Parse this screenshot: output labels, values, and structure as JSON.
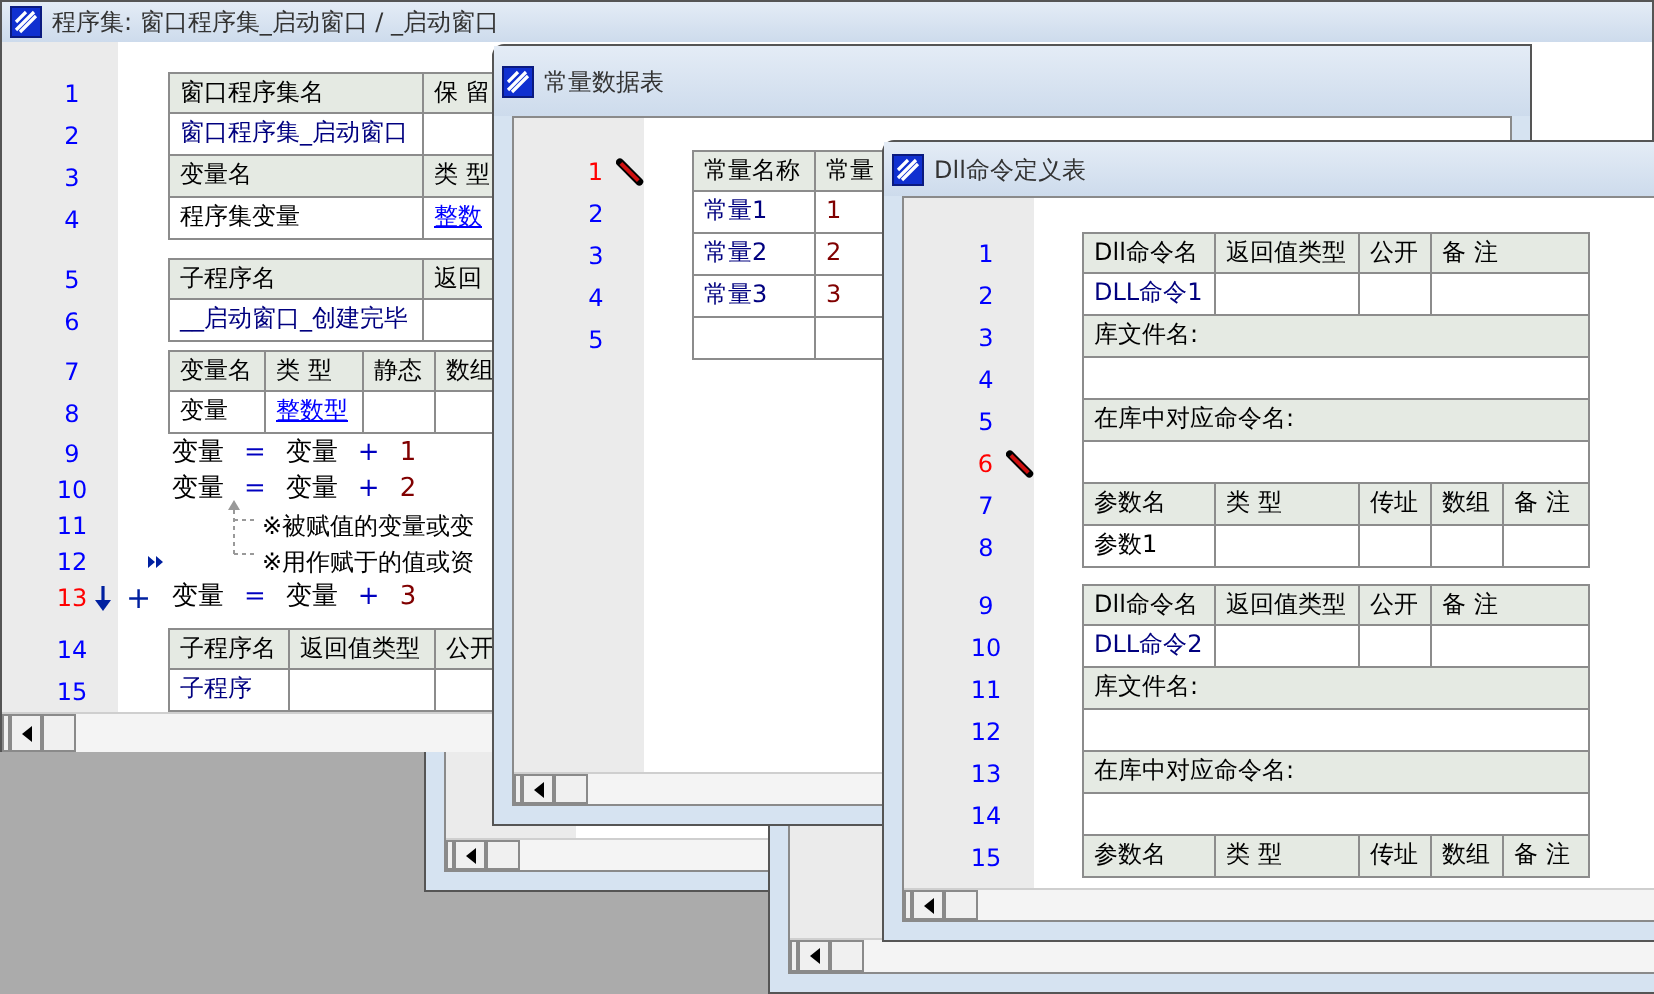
{
  "windows": [
    {
      "kind": "code",
      "title": "程序集: 窗口程序集_启动窗口 / _启动窗口",
      "blocks": [
        {
          "kind": "table",
          "rows": [
            {
              "line": "1",
              "current": false,
              "kind": "header",
              "cells": [
                {
                  "text": "窗口程序集名"
                },
                {
                  "text": "保 留"
                }
              ]
            },
            {
              "line": "2",
              "current": false,
              "kind": "data",
              "cells": [
                {
                  "text": "窗口程序集_启动窗口",
                  "kind": "name"
                },
                {}
              ]
            },
            {
              "line": "3",
              "current": false,
              "kind": "header",
              "cells": [
                {
                  "text": "变量名"
                },
                {
                  "text": "类 型"
                }
              ]
            },
            {
              "line": "4",
              "current": false,
              "kind": "data",
              "cells": [
                {
                  "text": "程序集变量"
                },
                {
                  "text": "整数",
                  "kind": "link"
                }
              ]
            }
          ]
        },
        {
          "kind": "table",
          "rows": [
            {
              "line": "5",
              "current": false,
              "kind": "header",
              "cells": [
                {
                  "text": "子程序名"
                },
                {
                  "text": "返回"
                }
              ]
            },
            {
              "line": "6",
              "current": false,
              "kind": "data",
              "cells": [
                {
                  "text": "__启动窗口_创建完毕",
                  "kind": "name"
                },
                {}
              ]
            }
          ]
        },
        {
          "kind": "table",
          "rows": [
            {
              "line": "7",
              "current": false,
              "kind": "header",
              "cells": [
                {
                  "text": "变量名"
                },
                {
                  "text": "类 型"
                },
                {
                  "text": "静态"
                },
                {
                  "text": "数组"
                }
              ]
            },
            {
              "line": "8",
              "current": false,
              "kind": "data",
              "cells": [
                {
                  "text": "变量"
                },
                {
                  "text": "整数型",
                  "kind": "link"
                },
                {},
                {}
              ]
            }
          ]
        },
        {
          "kind": "code",
          "lines": [
            {
              "line": "9",
              "current": false,
              "flagged": false,
              "kind": "code",
              "tokens": [
                {
                  "text": "变量",
                  "kind": "var"
                },
                {
                  "text": "=",
                  "kind": "op"
                },
                {
                  "text": "变量",
                  "kind": "var"
                },
                {
                  "text": "+",
                  "kind": "op"
                },
                {
                  "text": "1",
                  "kind": "num"
                }
              ]
            },
            {
              "line": "10",
              "current": false,
              "flagged": false,
              "kind": "code",
              "tokens": [
                {
                  "text": "变量",
                  "kind": "var"
                },
                {
                  "text": "=",
                  "kind": "op"
                },
                {
                  "text": "变量",
                  "kind": "var"
                },
                {
                  "text": "+",
                  "kind": "op"
                },
                {
                  "text": "2",
                  "kind": "num"
                }
              ]
            },
            {
              "line": "11",
              "current": false,
              "flagged": false,
              "kind": "comment",
              "text": "※被赋值的变量或变"
            },
            {
              "line": "12",
              "current": false,
              "flagged": true,
              "kind": "comment",
              "text": "※用作赋于的值或资"
            },
            {
              "line": "13",
              "current": true,
              "flagged": false,
              "kind": "code",
              "prefix": "+",
              "tokens": [
                {
                  "text": "变量",
                  "kind": "var"
                },
                {
                  "text": "=",
                  "kind": "op"
                },
                {
                  "text": "变量",
                  "kind": "var"
                },
                {
                  "text": "+",
                  "kind": "op"
                },
                {
                  "text": "3",
                  "kind": "num"
                }
              ]
            }
          ]
        },
        {
          "kind": "table",
          "rows": [
            {
              "line": "14",
              "current": false,
              "kind": "header",
              "cells": [
                {
                  "text": "子程序名"
                },
                {
                  "text": "返回值类型"
                },
                {
                  "text": "公开"
                }
              ]
            },
            {
              "line": "15",
              "current": false,
              "kind": "data",
              "cells": [
                {
                  "text": "子程序",
                  "kind": "name"
                },
                {},
                {}
              ]
            }
          ]
        }
      ]
    },
    {
      "kind": "table",
      "title": "常量数据表",
      "blocks": [
        {
          "kind": "table",
          "rows": [
            {
              "line": "1",
              "current": true,
              "kind": "header",
              "cells": [
                {
                  "text": "常量名称"
                },
                {
                  "text": "常量"
                }
              ]
            },
            {
              "line": "2",
              "current": false,
              "kind": "data",
              "cells": [
                {
                  "text": "常量1",
                  "kind": "name"
                },
                {
                  "text": "1",
                  "kind": "value"
                }
              ]
            },
            {
              "line": "3",
              "current": false,
              "kind": "data",
              "cells": [
                {
                  "text": "常量2",
                  "kind": "name"
                },
                {
                  "text": "2",
                  "kind": "value"
                }
              ]
            },
            {
              "line": "4",
              "current": false,
              "kind": "data",
              "cells": [
                {
                  "text": "常量3",
                  "kind": "name"
                },
                {
                  "text": "3",
                  "kind": "value"
                }
              ]
            },
            {
              "line": "5",
              "current": false,
              "kind": "data",
              "cells": [
                {},
                {}
              ]
            }
          ]
        }
      ]
    },
    {
      "kind": "table",
      "title": "Dll命令定义表",
      "blocks": [
        {
          "kind": "table",
          "rows": [
            {
              "line": "1",
              "current": false,
              "kind": "header",
              "cells": [
                {
                  "text": "Dll命令名"
                },
                {
                  "text": "返回值类型"
                },
                {
                  "text": "公开"
                },
                {
                  "text": "备 注"
                }
              ]
            },
            {
              "line": "2",
              "current": false,
              "kind": "data",
              "cells": [
                {
                  "text": "DLL命令1",
                  "kind": "name"
                },
                {},
                {},
                {}
              ]
            },
            {
              "line": "3",
              "current": false,
              "kind": "header",
              "cells": [
                {
                  "text": "库文件名:"
                }
              ]
            },
            {
              "line": "4",
              "current": false,
              "kind": "data",
              "cells": [
                {}
              ]
            },
            {
              "line": "5",
              "current": false,
              "kind": "header",
              "cells": [
                {
                  "text": "在库中对应命令名:"
                }
              ]
            },
            {
              "line": "6",
              "current": true,
              "kind": "data",
              "cells": [
                {}
              ]
            },
            {
              "line": "7",
              "current": false,
              "kind": "header",
              "cells": [
                {
                  "text": "参数名"
                },
                {
                  "text": "类 型"
                },
                {
                  "text": "传址"
                },
                {
                  "text": "数组"
                },
                {
                  "text": "备 注"
                }
              ]
            },
            {
              "line": "8",
              "current": false,
              "kind": "data",
              "cells": [
                {
                  "text": "参数1"
                },
                {},
                {},
                {},
                {}
              ]
            }
          ]
        },
        {
          "kind": "table",
          "rows": [
            {
              "line": "9",
              "current": false,
              "kind": "header",
              "cells": [
                {
                  "text": "Dll命令名"
                },
                {
                  "text": "返回值类型"
                },
                {
                  "text": "公开"
                },
                {
                  "text": "备 注"
                }
              ]
            },
            {
              "line": "10",
              "current": false,
              "kind": "data",
              "cells": [
                {
                  "text": "DLL命令2",
                  "kind": "name"
                },
                {},
                {},
                {}
              ]
            },
            {
              "line": "11",
              "current": false,
              "kind": "header",
              "cells": [
                {
                  "text": "库文件名:"
                }
              ]
            },
            {
              "line": "12",
              "current": false,
              "kind": "data",
              "cells": [
                {}
              ]
            },
            {
              "line": "13",
              "current": false,
              "kind": "header",
              "cells": [
                {
                  "text": "在库中对应命令名:"
                }
              ]
            },
            {
              "line": "14",
              "current": false,
              "kind": "data",
              "cells": [
                {}
              ]
            },
            {
              "line": "15",
              "current": false,
              "kind": "header",
              "cells": [
                {
                  "text": "参数名"
                },
                {
                  "text": "类 型"
                },
                {
                  "text": "传址"
                },
                {
                  "text": "数组"
                },
                {
                  "text": "备 注"
                }
              ]
            }
          ]
        }
      ]
    }
  ]
}
